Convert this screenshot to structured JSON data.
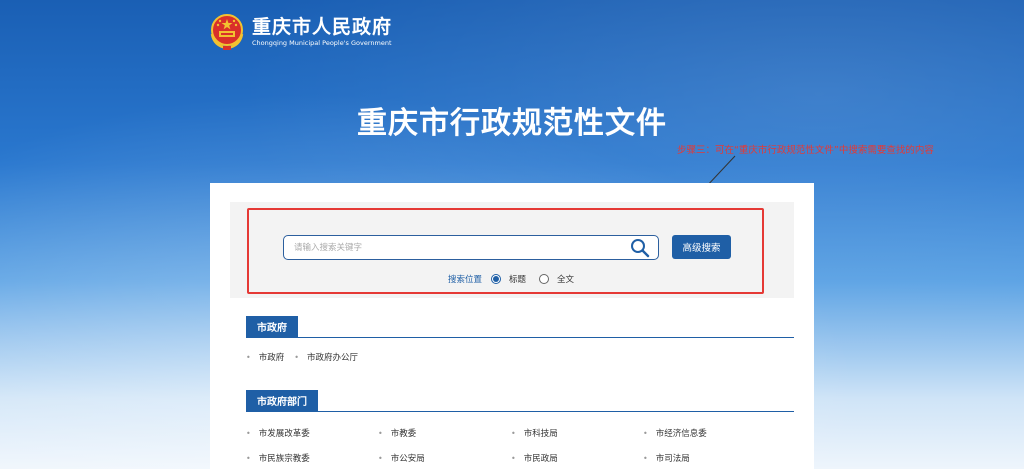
{
  "header": {
    "site_name_cn": "重庆市人民政府",
    "site_name_en": "Chongqing Municipal People's Government"
  },
  "hero": {
    "title": "重庆市行政规范性文件"
  },
  "annotation": {
    "text": "步骤三：可在“重庆市行政规范性文件”中搜索需要查找的内容",
    "color": "#e53935"
  },
  "search": {
    "placeholder": "请输入搜索关键字",
    "value": "",
    "advanced_button": "高级搜索",
    "scope_label": "搜索位置",
    "options": [
      {
        "label": "标题",
        "selected": true
      },
      {
        "label": "全文",
        "selected": false
      }
    ]
  },
  "sections": [
    {
      "title": "市政府",
      "links": [
        "市政府",
        "市政府办公厅"
      ]
    },
    {
      "title": "市政府部门",
      "rows": [
        [
          "市发展改革委",
          "市教委",
          "市科技局",
          "市经济信息委"
        ],
        [
          "市民族宗教委",
          "市公安局",
          "市民政局",
          "市司法局"
        ]
      ]
    }
  ],
  "colors": {
    "primary": "#1f5fa6",
    "highlight": "#e53935"
  }
}
